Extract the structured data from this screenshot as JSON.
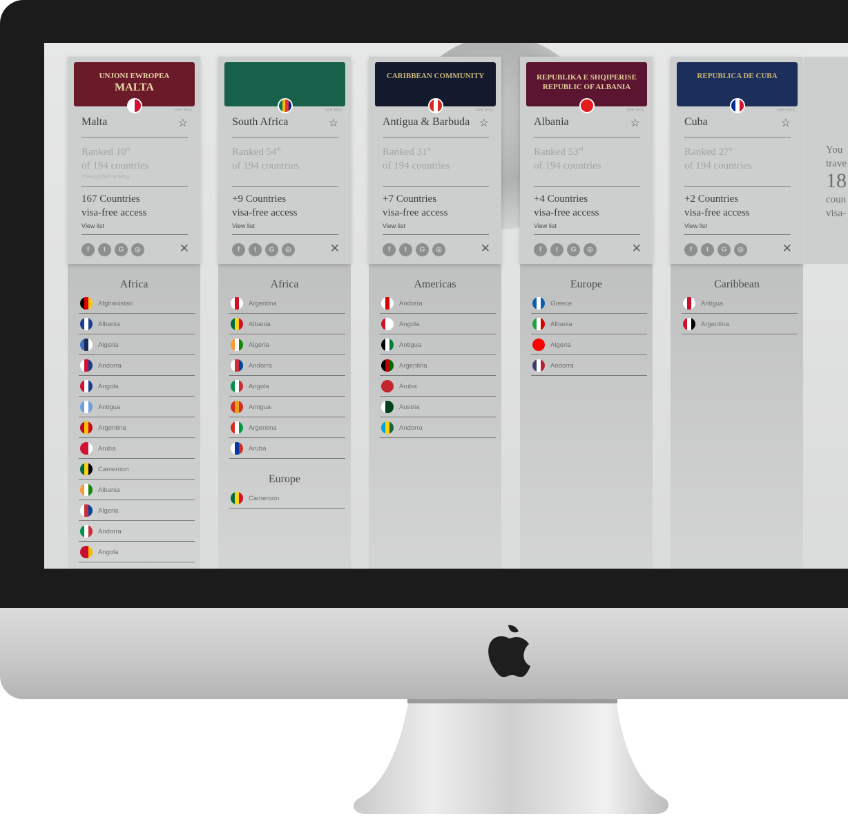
{
  "cards": [
    {
      "country": "Malta",
      "passport": {
        "line1": "UNJONI EWROPEA",
        "line2": "MALTA",
        "color": "#6b1a2a",
        "text_color": "#e9d9a8"
      },
      "flag": [
        "#ffffff",
        "#d21034"
      ],
      "see_less": "see less",
      "ranked_line1": "Ranked 10",
      "ranked_sup": "th",
      "ranked_line2": "of 194 countries",
      "global_ranking": "View global ranking",
      "access_line1": "167 Countries",
      "access_line2": "visa-free access",
      "view_list": "View list",
      "region": "Africa",
      "items": [
        {
          "name": "Afghanistan",
          "flag": [
            "#000000",
            "#dd0000",
            "#ffce00"
          ]
        },
        {
          "name": "Albania",
          "flag": [
            "#1d3f8f",
            "#ffffff",
            "#1d3f8f"
          ]
        },
        {
          "name": "Algeria",
          "flag": [
            "#3a6fc4",
            "#1b2a55",
            "#ffffff"
          ]
        },
        {
          "name": "Andorra",
          "flag": [
            "#ffffff",
            "#d21034",
            "#1b3f8f"
          ]
        },
        {
          "name": "Angola",
          "flag": [
            "#d21034",
            "#ffffff",
            "#1b3f8f"
          ]
        },
        {
          "name": "Antigua",
          "flag": [
            "#6ca0dc",
            "#ffffff",
            "#6ca0dc"
          ]
        },
        {
          "name": "Argentina",
          "flag": [
            "#c60b1e",
            "#ffc400",
            "#c60b1e"
          ]
        },
        {
          "name": "Aruba",
          "flag": [
            "#d21034",
            "#d21034",
            "#ffffff"
          ]
        },
        {
          "name": "Cameroon",
          "flag": [
            "#006b3f",
            "#fcd116",
            "#000000"
          ]
        },
        {
          "name": "Albania",
          "flag": [
            "#ff9933",
            "#ffffff",
            "#138808"
          ]
        },
        {
          "name": "Algeria",
          "flag": [
            "#ffffff",
            "#cd2e3a",
            "#0047a0"
          ]
        },
        {
          "name": "Andorra",
          "flag": [
            "#009246",
            "#ffffff",
            "#ce2b37"
          ]
        },
        {
          "name": "Angola",
          "flag": [
            "#c8102e",
            "#c8102e",
            "#f1bf00"
          ]
        }
      ]
    },
    {
      "country": "South Africa",
      "passport": {
        "line1": "",
        "line2": "",
        "color": "#17614a",
        "text_color": "#d8e6dd"
      },
      "flag": [
        "#007a4d",
        "#ffb612",
        "#de3831",
        "#002395"
      ],
      "see_less": "see less",
      "ranked_line1": "Ranked 54",
      "ranked_sup": "th",
      "ranked_line2": "of 194 countries",
      "global_ranking": "",
      "access_line1": "+9 Countries",
      "access_line2": "visa-free access",
      "view_list": "View list",
      "region": "Africa",
      "items": [
        {
          "name": "Argentina",
          "flag": [
            "#ffffff",
            "#ce1124",
            "#ffffff"
          ]
        },
        {
          "name": "Albania",
          "flag": [
            "#006b3f",
            "#fcd116",
            "#ce1126"
          ]
        },
        {
          "name": "Algeria",
          "flag": [
            "#ff9933",
            "#ffffff",
            "#138808"
          ]
        },
        {
          "name": "Andorra",
          "flag": [
            "#ffffff",
            "#cd2e3a",
            "#0047a0"
          ]
        },
        {
          "name": "Angola",
          "flag": [
            "#009246",
            "#ffffff",
            "#ce2b37"
          ]
        },
        {
          "name": "Antigua",
          "flag": [
            "#d52b1e",
            "#e8a317",
            "#d52b1e"
          ]
        },
        {
          "name": "Argentina",
          "flag": [
            "#d52b1e",
            "#ffffff",
            "#009a44"
          ]
        },
        {
          "name": "Aruba",
          "flag": [
            "#ffffff",
            "#0039a6",
            "#d52b1e"
          ]
        }
      ],
      "region2": "Europe",
      "items2": [
        {
          "name": "Cameroon",
          "flag": [
            "#006b3f",
            "#fcd116",
            "#ce1126"
          ]
        }
      ]
    },
    {
      "country": "Antigua & Barbuda",
      "passport": {
        "line1": "CARIBBEAN COMMUNITY",
        "line2": "",
        "color": "#141a2e",
        "text_color": "#c9b77a"
      },
      "flag": [
        "#d52b1e",
        "#ffffff",
        "#d52b1e"
      ],
      "see_less": "see less",
      "ranked_line1": "Ranked 31",
      "ranked_sup": "st",
      "ranked_line2": "of 194 countries",
      "global_ranking": "",
      "access_line1": "+7 Countries",
      "access_line2": "visa-free access",
      "view_list": "View list",
      "region": "Americas",
      "items": [
        {
          "name": "Andorra",
          "flag": [
            "#ffffff",
            "#da0000",
            "#ffffff"
          ]
        },
        {
          "name": "Angola",
          "flag": [
            "#ce1126",
            "#ffffff",
            "#ffffff"
          ]
        },
        {
          "name": "Antigua",
          "flag": [
            "#000000",
            "#ffffff",
            "#007a3d"
          ]
        },
        {
          "name": "Argentina",
          "flag": [
            "#000000",
            "#bb0000",
            "#006600"
          ]
        },
        {
          "name": "Aruba",
          "flag": [
            "#c1272d",
            "#c1272d",
            "#c1272d"
          ]
        },
        {
          "name": "Austria",
          "flag": [
            "#ffffff",
            "#01411c",
            "#01411c"
          ]
        },
        {
          "name": "Andorra",
          "flag": [
            "#00a1de",
            "#fad201",
            "#20603d"
          ]
        }
      ]
    },
    {
      "country": "Albania",
      "passport": {
        "line1": "REPUBLIKA E SHQIPERISE",
        "line2": "REPUBLIC OF ALBANIA",
        "color": "#5b1530",
        "text_color": "#e3cf9a"
      },
      "flag": [
        "#e41e20",
        "#e41e20",
        "#e41e20"
      ],
      "see_less": "see less",
      "ranked_line1": "Ranked 53",
      "ranked_sup": "rd",
      "ranked_line2": "of 194 countries",
      "global_ranking": "",
      "access_line1": "+4 Countries",
      "access_line2": "visa-free access",
      "view_list": "View list",
      "region": "Europe",
      "items": [
        {
          "name": "Greece",
          "flag": [
            "#0d5eaf",
            "#ffffff",
            "#0d5eaf"
          ]
        },
        {
          "name": "Albania",
          "flag": [
            "#239f40",
            "#ffffff",
            "#da0000"
          ]
        },
        {
          "name": "Algeria",
          "flag": [
            "#ff0000",
            "#ff0000",
            "#ff0000"
          ]
        },
        {
          "name": "Andorra",
          "flag": [
            "#3c3b6e",
            "#ffffff",
            "#b22234"
          ]
        }
      ]
    },
    {
      "country": "Cuba",
      "passport": {
        "line1": "REPUBLICA DE CUBA",
        "line2": "",
        "color": "#1c2f5a",
        "text_color": "#c8b479"
      },
      "flag": [
        "#002a8f",
        "#ffffff",
        "#cf142b"
      ],
      "see_less": "see less",
      "ranked_line1": "Ranked 27",
      "ranked_sup": "st",
      "ranked_line2": "of 194 countries",
      "global_ranking": "",
      "access_line1": "+2 Countries",
      "access_line2": "visa-free access",
      "view_list": "View list",
      "region": "Caribbean",
      "items": [
        {
          "name": "Antigua",
          "flag": [
            "#ffffff",
            "#c8102e",
            "#ffffff"
          ]
        },
        {
          "name": "Argentina",
          "flag": [
            "#ce1126",
            "#ffffff",
            "#000000"
          ]
        }
      ]
    }
  ],
  "right_panel": {
    "l1": "You",
    "l2": "trave",
    "l3": "18",
    "l4": "coun",
    "l5": "visa-"
  }
}
